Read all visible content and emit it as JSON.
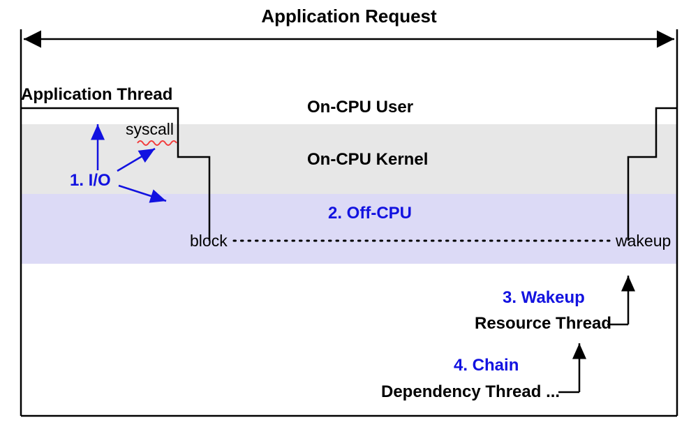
{
  "title": "Application Request",
  "labels": {
    "app_thread": "Application Thread",
    "syscall": "syscall",
    "on_cpu_user": "On-CPU User",
    "on_cpu_kernel": "On-CPU Kernel",
    "off_cpu": "2. Off-CPU",
    "io": "1. I/O",
    "block": "block",
    "wakeup_small": "wakeup",
    "wakeup_step": "3. Wakeup",
    "resource_thread": "Resource Thread",
    "chain": "4. Chain",
    "dependency_thread": "Dependency Thread ..."
  },
  "colors": {
    "offcpu_band": "#dcdaf6",
    "kernel_band": "#e7e7e7",
    "blue": "#1212e0",
    "squiggle": "#f23b3b"
  }
}
